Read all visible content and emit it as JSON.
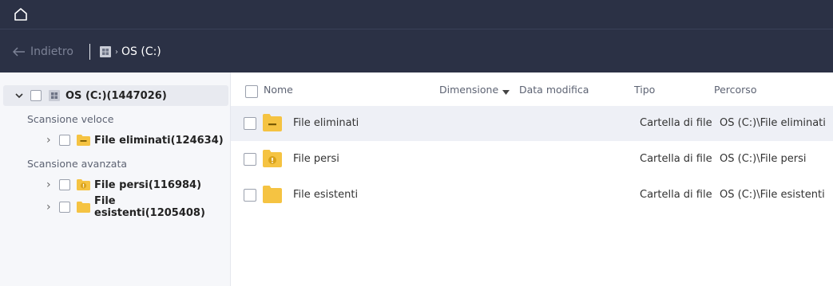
{
  "topbar": {
    "home_icon": "home-icon"
  },
  "nav": {
    "back_label": "Indietro",
    "breadcrumb_drive": "OS (C:)"
  },
  "tree": {
    "root_label": "OS (C:)(1447026)",
    "section_quick": "Scansione veloce",
    "section_advanced": "Scansione avanzata",
    "items": [
      {
        "label": "File eliminati(124634)"
      },
      {
        "label": "File persi(116984)"
      },
      {
        "label": "File esistenti(1205408)"
      }
    ]
  },
  "table": {
    "columns": {
      "name": "Nome",
      "size": "Dimensione",
      "modified": "Data modifica",
      "type": "Tipo",
      "path": "Percorso"
    },
    "rows": [
      {
        "name": "File eliminati",
        "type": "Cartella di file",
        "path": "OS (C:)\\File eliminati"
      },
      {
        "name": "File persi",
        "type": "Cartella di file",
        "path": "OS (C:)\\File persi"
      },
      {
        "name": "File esistenti",
        "type": "Cartella di file",
        "path": "OS (C:)\\File esistenti"
      }
    ]
  },
  "colors": {
    "header_bg": "#2b3145",
    "folder": "#f5c342",
    "lost_badge": "#d9a21a"
  }
}
